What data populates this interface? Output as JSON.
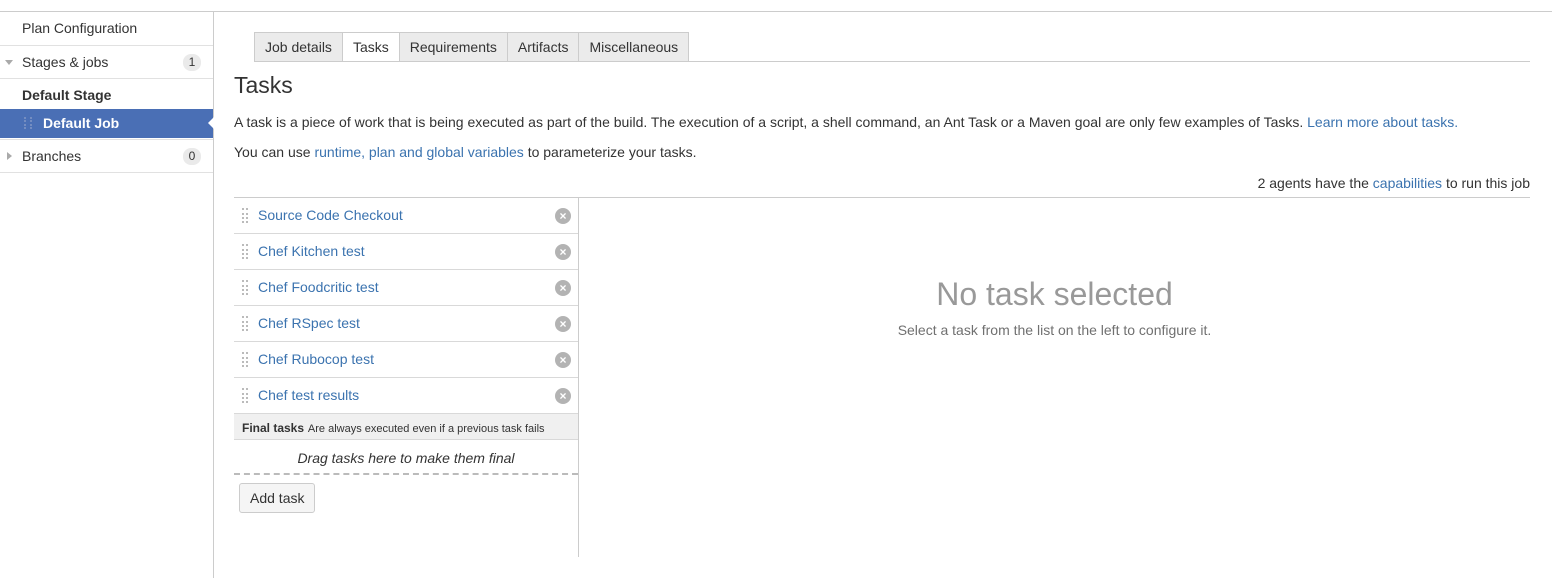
{
  "sidebar": {
    "plan_configuration": "Plan Configuration",
    "stages_jobs": {
      "label": "Stages & jobs",
      "count": "1"
    },
    "default_stage": "Default Stage",
    "default_job": "Default Job",
    "branches": {
      "label": "Branches",
      "count": "0"
    }
  },
  "tabs": [
    "Job details",
    "Tasks",
    "Requirements",
    "Artifacts",
    "Miscellaneous"
  ],
  "active_tab": "Tasks",
  "page_title": "Tasks",
  "description": {
    "text": "A task is a piece of work that is being executed as part of the build. The execution of a script, a shell command, an Ant Task or a Maven goal are only few examples of Tasks.",
    "link": "Learn more about tasks."
  },
  "variables": {
    "prefix": "You can use",
    "link": "runtime, plan and global variables",
    "suffix": "to parameterize your tasks."
  },
  "agents": {
    "prefix": "2 agents have the",
    "link": "capabilities",
    "suffix": "to run this job"
  },
  "tasks": [
    "Source Code Checkout",
    "Chef Kitchen test",
    "Chef Foodcritic test",
    "Chef RSpec test",
    "Chef Rubocop test",
    "Chef test results"
  ],
  "final_tasks": {
    "title": "Final tasks",
    "note": "Are always executed even if a previous task fails",
    "drop_hint": "Drag tasks here to make them final"
  },
  "add_task_label": "Add task",
  "empty_state": {
    "title": "No task selected",
    "subtitle": "Select a task from the list on the left to configure it."
  },
  "icons": {
    "remove": "remove-circle-icon",
    "drag": "drag-handle-icon"
  },
  "colors": {
    "link": "#3b73af",
    "selected_bg": "#4a6fb5"
  }
}
